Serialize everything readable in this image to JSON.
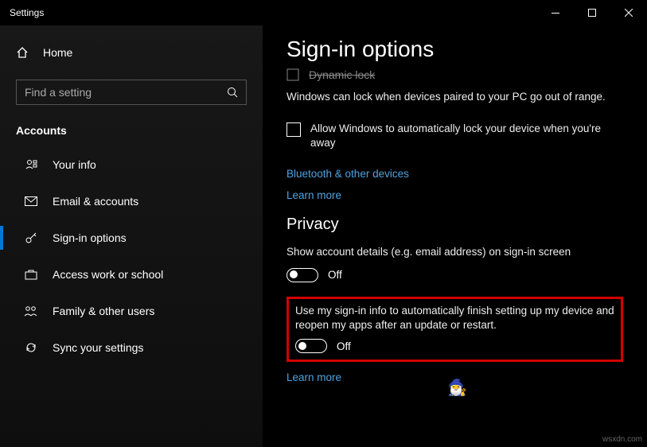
{
  "window": {
    "title": "Settings"
  },
  "sidebar": {
    "home": "Home",
    "search_placeholder": "Find a setting",
    "section": "Accounts",
    "items": [
      {
        "label": "Your info"
      },
      {
        "label": "Email & accounts"
      },
      {
        "label": "Sign-in options"
      },
      {
        "label": "Access work or school"
      },
      {
        "label": "Family & other users"
      },
      {
        "label": "Sync your settings"
      }
    ]
  },
  "main": {
    "title": "Sign-in options",
    "dynamic_lock_strike": "Dynamic lock",
    "dynamic_lock_desc": "Windows can lock when devices paired to your PC go out of range.",
    "dynamic_lock_checkbox": "Allow Windows to automatically lock your device when you're away",
    "bluetooth_link": "Bluetooth & other devices",
    "learn_more": "Learn more",
    "privacy_header": "Privacy",
    "privacy_account_details": "Show account details (e.g. email address) on sign-in screen",
    "privacy_signin_info": "Use my sign-in info to automatically finish setting up my device and reopen my apps after an update or restart.",
    "toggle_off": "Off"
  },
  "watermark": "wsxdn.com"
}
